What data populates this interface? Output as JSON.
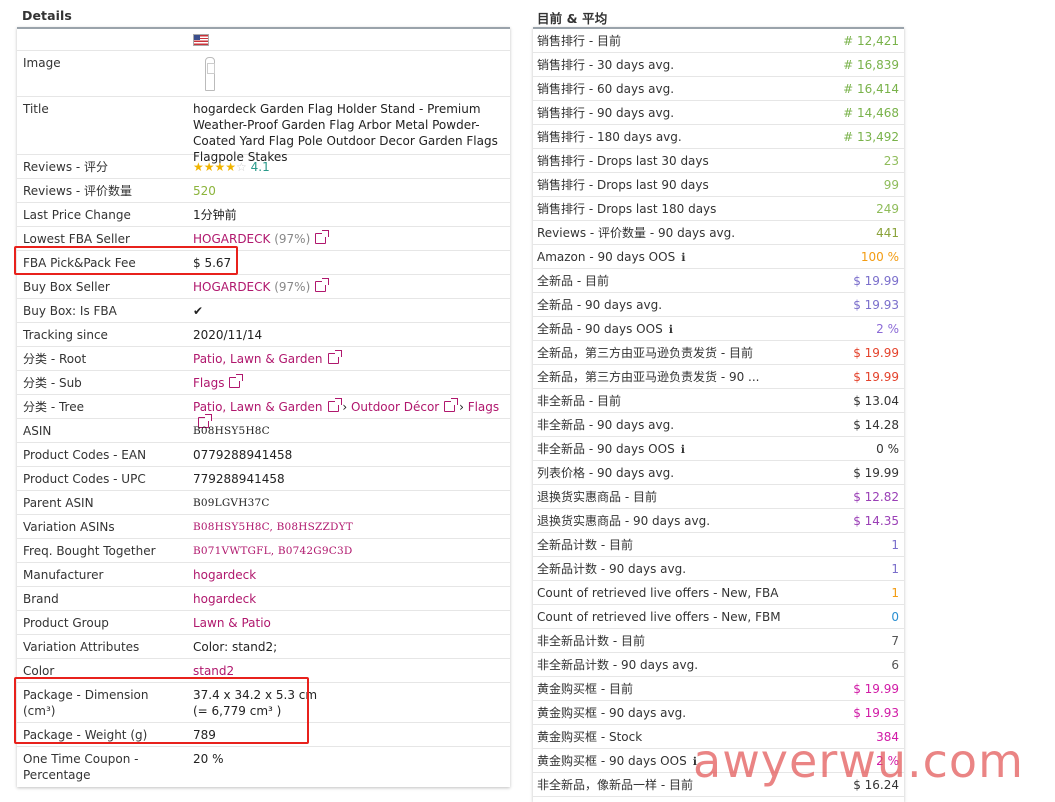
{
  "details": {
    "heading": "Details",
    "rows": [
      {
        "label": "",
        "value": ""
      },
      {
        "label": "Image",
        "value": ""
      },
      {
        "label": "Title",
        "value": "hogardeck Garden Flag Holder Stand - Premium Weather-Proof Garden Flag Arbor Metal Powder-Coated Yard Flag Pole Outdoor Decor Garden Flags Flagpole Stakes"
      },
      {
        "label": "Reviews - 评分",
        "value": "4.1"
      },
      {
        "label": "Reviews - 评价数量",
        "value": "520"
      },
      {
        "label": "Last Price Change",
        "value": "1分钟前"
      },
      {
        "label": "Lowest FBA Seller",
        "value": "HOGARDECK",
        "extra": "(97%)"
      },
      {
        "label": "FBA Pick&Pack Fee",
        "value": "$ 5.67"
      },
      {
        "label": "Buy Box Seller",
        "value": "HOGARDECK",
        "extra": "(97%)"
      },
      {
        "label": "Buy Box: Is FBA",
        "value": "✔"
      },
      {
        "label": "Tracking since",
        "value": "2020/11/14"
      },
      {
        "label": "分类 - Root",
        "value": "Patio, Lawn & Garden"
      },
      {
        "label": "分类 - Sub",
        "value": "Flags"
      },
      {
        "label": "分类 - Tree",
        "value": "Patio, Lawn & Garden",
        "tree2": "Outdoor Décor",
        "tree3": "Flags"
      },
      {
        "label": "ASIN",
        "value": "B08HSY5H8C"
      },
      {
        "label": "Product Codes - EAN",
        "value": "0779288941458"
      },
      {
        "label": "Product Codes - UPC",
        "value": "779288941458"
      },
      {
        "label": "Parent ASIN",
        "value": "B09LGVH37C"
      },
      {
        "label": "Variation ASINs",
        "value": "B08HSY5H8C, B08HSZZDYT"
      },
      {
        "label": "Freq. Bought Together",
        "value": "B071VWTGFL, B0742G9C3D"
      },
      {
        "label": "Manufacturer",
        "value": "hogardeck"
      },
      {
        "label": "Brand",
        "value": "hogardeck"
      },
      {
        "label": "Product Group",
        "value": "Lawn & Patio"
      },
      {
        "label": "Variation Attributes",
        "value": "Color: stand2;"
      },
      {
        "label": "Color",
        "value": "stand2"
      },
      {
        "label": "Package - Dimension (cm³)",
        "value": "37.4 x 34.2 x 5.3 cm",
        "value2": "(= 6,779 cm³ )"
      },
      {
        "label": "Package - Weight (g)",
        "value": "789"
      },
      {
        "label": "One Time Coupon - Percentage",
        "value": "20 %"
      }
    ]
  },
  "averages": {
    "heading": "目前 & 平均",
    "rows": [
      {
        "label": "销售排行 - 目前",
        "value": "# 12,421",
        "color": "#79b24a"
      },
      {
        "label": "销售排行 - 30 days avg.",
        "value": "# 16,839",
        "color": "#79b24a"
      },
      {
        "label": "销售排行 - 60 days avg.",
        "value": "# 16,414",
        "color": "#79b24a"
      },
      {
        "label": "销售排行 - 90 days avg.",
        "value": "# 14,468",
        "color": "#79b24a"
      },
      {
        "label": "销售排行 - 180 days avg.",
        "value": "# 13,492",
        "color": "#79b24a"
      },
      {
        "label": "销售排行 - Drops last 30 days",
        "value": "23",
        "color": "#8fbc5a"
      },
      {
        "label": "销售排行 - Drops last 90 days",
        "value": "99",
        "color": "#8fbc5a"
      },
      {
        "label": "销售排行 - Drops last 180 days",
        "value": "249",
        "color": "#8fbc5a"
      },
      {
        "label": "Reviews - 评价数量 - 90 days avg.",
        "value": "441",
        "color": "#8aa33a"
      },
      {
        "label": "Amazon - 90 days OOS",
        "value": "100 %",
        "color": "#f39c12",
        "info": true
      },
      {
        "label": "全新品 - 目前",
        "value": "$ 19.99",
        "color": "#7a6ecb"
      },
      {
        "label": "全新品 - 90 days avg.",
        "value": "$ 19.93",
        "color": "#7a6ecb"
      },
      {
        "label": "全新品 - 90 days OOS",
        "value": "2 %",
        "color": "#8b6ad6",
        "info": true
      },
      {
        "label": "全新品，第三方由亚马逊负责发货 - 目前",
        "value": "$ 19.99",
        "color": "#e4422b"
      },
      {
        "label": "全新品，第三方由亚马逊负责发货 - 90 ...",
        "value": "$ 19.99",
        "color": "#e4422b"
      },
      {
        "label": "非全新品 - 目前",
        "value": "$ 13.04",
        "color": "#333333"
      },
      {
        "label": "非全新品 - 90 days avg.",
        "value": "$ 14.28",
        "color": "#333333"
      },
      {
        "label": "非全新品 - 90 days OOS",
        "value": "0 %",
        "color": "#333333",
        "info": true
      },
      {
        "label": "列表价格 - 90 days avg.",
        "value": "$ 19.99",
        "color": "#333333"
      },
      {
        "label": "退换货实惠商品 - 目前",
        "value": "$ 12.82",
        "color": "#9a3fb6"
      },
      {
        "label": "退换货实惠商品 - 90 days avg.",
        "value": "$ 14.35",
        "color": "#9a3fb6"
      },
      {
        "label": "全新品计数 - 目前",
        "value": "1",
        "color": "#7a6ecb"
      },
      {
        "label": "全新品计数 - 90 days avg.",
        "value": "1",
        "color": "#7a6ecb"
      },
      {
        "label": "Count of retrieved live offers - New, FBA",
        "value": "1",
        "color": "#f39c12"
      },
      {
        "label": "Count of retrieved live offers - New, FBM",
        "value": "0",
        "color": "#2a8fd1"
      },
      {
        "label": "非全新品计数 - 目前",
        "value": "7",
        "color": "#555555"
      },
      {
        "label": "非全新品计数 - 90 days avg.",
        "value": "6",
        "color": "#555555"
      },
      {
        "label": "黄金购买框 - 目前",
        "value": "$ 19.99",
        "color": "#d11aa6"
      },
      {
        "label": "黄金购买框 - 90 days avg.",
        "value": "$ 19.93",
        "color": "#d11aa6"
      },
      {
        "label": "黄金购买框 - Stock",
        "value": "384",
        "color": "#d11aa6"
      },
      {
        "label": "黄金购买框 - 90 days OOS",
        "value": "2 %",
        "color": "#d11aa6",
        "info": true
      },
      {
        "label": "非全新品，像新品一样 - 目前",
        "value": "$ 16.24",
        "color": "#333333"
      }
    ]
  },
  "info_icon": "ℹ",
  "flag_icon": "us-flag-icon",
  "external_icon": "external-link-icon",
  "watermark": "awyerwu.com"
}
